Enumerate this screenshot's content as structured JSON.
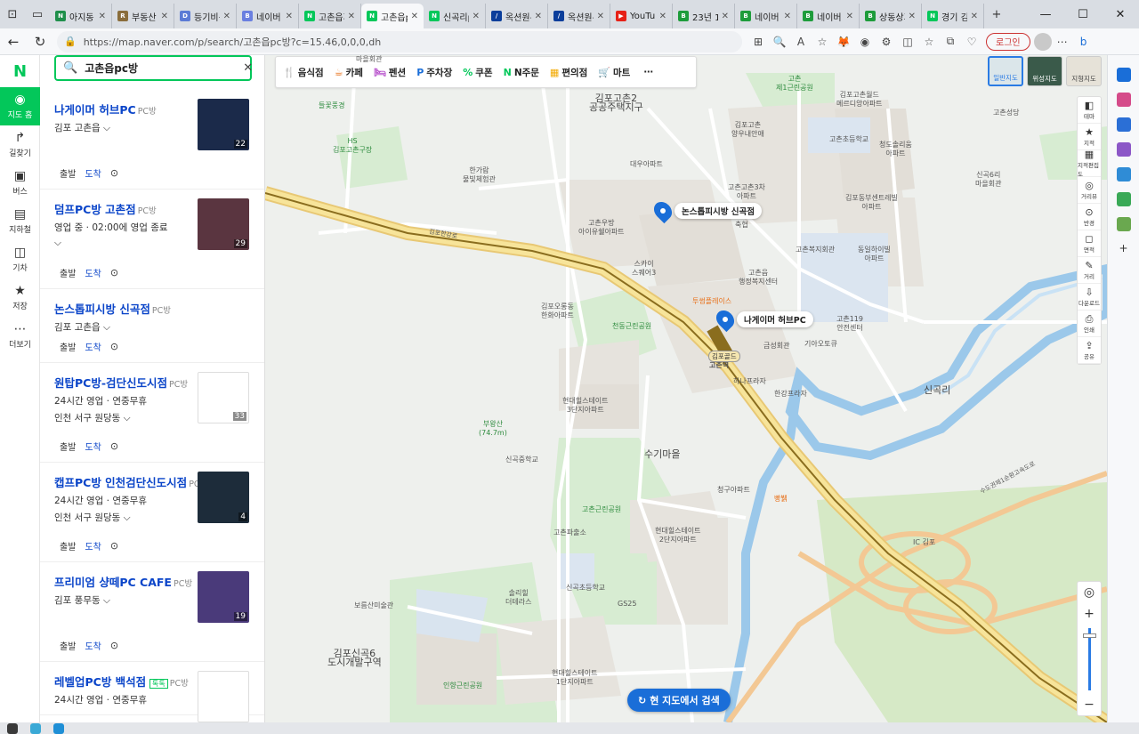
{
  "browser": {
    "tabs": [
      {
        "label": "아지동 대",
        "fav_color": "#1f8f4b",
        "fav_text": "N"
      },
      {
        "label": "부동산 대",
        "fav_color": "#8a6d3b",
        "fav_text": "R"
      },
      {
        "label": "등기비용 ",
        "fav_color": "#5b7bd5",
        "fav_text": "D"
      },
      {
        "label": "네이버 블",
        "fav_color": "#6a7fe0",
        "fav_text": "B"
      },
      {
        "label": "고촌읍피",
        "fav_color": "#03c75a",
        "fav_text": "N"
      },
      {
        "label": "고촌읍pc",
        "fav_color": "#03c75a",
        "fav_text": "N",
        "active": true
      },
      {
        "label": "신곡리pc",
        "fav_color": "#03c75a",
        "fav_text": "N"
      },
      {
        "label": "옥션원-경",
        "fav_color": "#0b3e9b",
        "fav_text": "/"
      },
      {
        "label": "옥션원-경",
        "fav_color": "#0b3e9b",
        "fav_text": "/"
      },
      {
        "label": "YouTube",
        "fav_color": "#e62117",
        "fav_text": "▶"
      },
      {
        "label": "23년 10월",
        "fav_color": "#1e9c3b",
        "fav_text": "B"
      },
      {
        "label": "네이버 블",
        "fav_color": "#1e9c3b",
        "fav_text": "B"
      },
      {
        "label": "네이버 블",
        "fav_color": "#1e9c3b",
        "fav_text": "B"
      },
      {
        "label": "상동상가",
        "fav_color": "#1e9c3b",
        "fav_text": "B"
      },
      {
        "label": "경기 김포",
        "fav_color": "#03c75a",
        "fav_text": "N"
      }
    ],
    "new_tab": "+",
    "url": "https://map.naver.com/p/search/고촌읍pc방?c=15.46,0,0,0,dh",
    "login_label": "로그인"
  },
  "rail": {
    "logo": "N",
    "items": [
      {
        "label": "지도 홈",
        "icon": "◉",
        "active": true
      },
      {
        "label": "길찾기",
        "icon": "↱"
      },
      {
        "label": "버스",
        "icon": "▣"
      },
      {
        "label": "지하철",
        "icon": "▤"
      },
      {
        "label": "기차",
        "icon": "◫"
      },
      {
        "label": "저장",
        "icon": "★"
      },
      {
        "label": "더보기",
        "icon": "⋯"
      }
    ]
  },
  "search": {
    "query": "고촌읍pc방"
  },
  "results": [
    {
      "title": "나게이머 허브PC",
      "category": "PC방",
      "lines": [
        "김포 고촌읍 ⌵"
      ],
      "depart": "출발",
      "arrive": "도착",
      "photo_count": "22",
      "thumb": "#1b2a4a"
    },
    {
      "title": "덤프PC방 고촌점",
      "category": "PC방",
      "lines": [
        "영업 중 · 02:00에 영업 종료",
        "⌵"
      ],
      "depart": "출발",
      "arrive": "도착",
      "photo_count": "29",
      "thumb": "#5a3540"
    },
    {
      "title": "논스톱피시방 신곡점",
      "category": "PC방",
      "lines": [
        "김포 고촌읍 ⌵"
      ],
      "depart": "출발",
      "arrive": "도착"
    },
    {
      "title": "원탑PC방-검단신도시점",
      "category": "PC방",
      "lines": [
        "24시간 영업 · 연중무휴",
        "인천 서구 원당동 ⌵"
      ],
      "depart": "출발",
      "arrive": "도착",
      "photo_count": "33",
      "thumb": "#ffffff"
    },
    {
      "title": "캡프PC방 인천검단신도시점",
      "category": "PC방",
      "lines": [
        "24시간 영업 · 연중무휴",
        "인천 서구 원당동 ⌵"
      ],
      "depart": "출발",
      "arrive": "도착",
      "photo_count": "4",
      "thumb": "#1d2c3a"
    },
    {
      "title": "프리미엄 샹떼PC CAFE",
      "category": "PC방",
      "lines": [
        "김포 풍무동 ⌵"
      ],
      "depart": "출발",
      "arrive": "도착",
      "photo_count": "19",
      "thumb": "#4a3a7a"
    },
    {
      "title": "레벨업PC방 백석점",
      "category": "PC방",
      "badge": "톡톡",
      "lines": [
        "24시간 영업 · 연중무휴"
      ],
      "thumb": "#ffffff"
    }
  ],
  "map": {
    "categories": [
      {
        "label": "음식점",
        "icon": "🍴",
        "color": "#e8721c"
      },
      {
        "label": "카페",
        "icon": "☕",
        "color": "#e8721c"
      },
      {
        "label": "펜션",
        "icon": "🛏",
        "color": "#b347c9"
      },
      {
        "label": "주차장",
        "icon": "P",
        "color": "#1a6ed8"
      },
      {
        "label": "쿠폰",
        "icon": "%",
        "color": "#03c75a"
      },
      {
        "label": "N주문",
        "icon": "N",
        "color": "#03c75a"
      },
      {
        "label": "편의점",
        "icon": "▦",
        "color": "#f2a900"
      },
      {
        "label": "마트",
        "icon": "🛒",
        "color": "#f2a900"
      },
      {
        "label": "⋯",
        "icon": "",
        "color": "#333"
      }
    ],
    "map_types": [
      {
        "label": "일반지도",
        "active": true
      },
      {
        "label": "위성지도"
      },
      {
        "label": "지형지도"
      }
    ],
    "tools": [
      {
        "label": "테마",
        "icon": "◧"
      },
      {
        "label": "지적",
        "icon": "★"
      },
      {
        "label": "지적편집도",
        "icon": "▦"
      },
      {
        "label": "거리뷰",
        "icon": "◎"
      },
      {
        "label": "반경",
        "icon": "⊙"
      },
      {
        "label": "면적",
        "icon": "◻"
      },
      {
        "label": "거리",
        "icon": "✎"
      },
      {
        "label": "다운로드",
        "icon": "⇩"
      },
      {
        "label": "인쇄",
        "icon": "⎙"
      },
      {
        "label": "공유",
        "icon": "⇪"
      }
    ],
    "markers": [
      {
        "label": "논스톱피시방 신곡점"
      },
      {
        "label": "나게이머 허브PC"
      }
    ],
    "search_here": "현 지도에서 검색",
    "places": {
      "l1": "풍곡2리\n마을회관",
      "l2": "들꽃풍경",
      "l3": "HS\n김포고촌구장",
      "l4": "한가람\n물빛체험관",
      "l5": "김포고촌2\n공공주택지구",
      "l6": "고촌\n제1근린공원",
      "l7": "김포고촌월드\n메르디앙아파트",
      "l8": "고촌성당",
      "l9": "김포고촌\n양우내안애",
      "l10": "대우아파트",
      "l11": "고촌우방\n아이유쉘아파트",
      "l12": "스카이\n스퀘어3",
      "l13": "김포오롱동\n한화아파트",
      "l14": "천동근린공원",
      "l15": "고촌읍\n행정복지센터",
      "l16": "고촌복지회관",
      "l17": "고촌119\n안전센터",
      "l18": "기아오토큐",
      "l19": "금성회관",
      "l20": "고촌역",
      "l21": "김포골드",
      "l22": "하나프라자",
      "l23": "한강프라자",
      "l24": "신곡리",
      "l25": "현대힐스테이트\n3단지아파트",
      "l26": "부왕산\n(74.7m)",
      "l27": "신곡중학교",
      "l28": "수기마을",
      "l29": "청구아파트",
      "l30": "고촌근린공원",
      "l31": "고촌파출소",
      "l32": "현대힐스테이트\n2단지아파트",
      "l33": "신곡초등학교",
      "l34": "솔리힐\n더테라스",
      "l35": "GS25",
      "l36": "보름산미술관",
      "l37": "김포신곡6\n도시개발구역",
      "l38": "인향근린공원",
      "l39": "현대힐스테이트\n1단지아파트",
      "l40": "고촌초등학교",
      "l41": "청도솔리움\n아파트",
      "l42": "신곡6리\n마을회관",
      "l43": "김포동부센트레빌\n아파트",
      "l44": "동일하이빌\n아파트",
      "l45": "고촌고촌3차\n아파트",
      "l46": "투썸플레이스",
      "l47": "빵뷁",
      "l48": "김포한강로",
      "l49": "수도권제1순환고속도로",
      "l50": "IC 김포",
      "l51": "축협"
    }
  },
  "colors": {
    "brand": "#03c75a",
    "link": "#0b45c9",
    "marker": "#1a6ed8"
  }
}
